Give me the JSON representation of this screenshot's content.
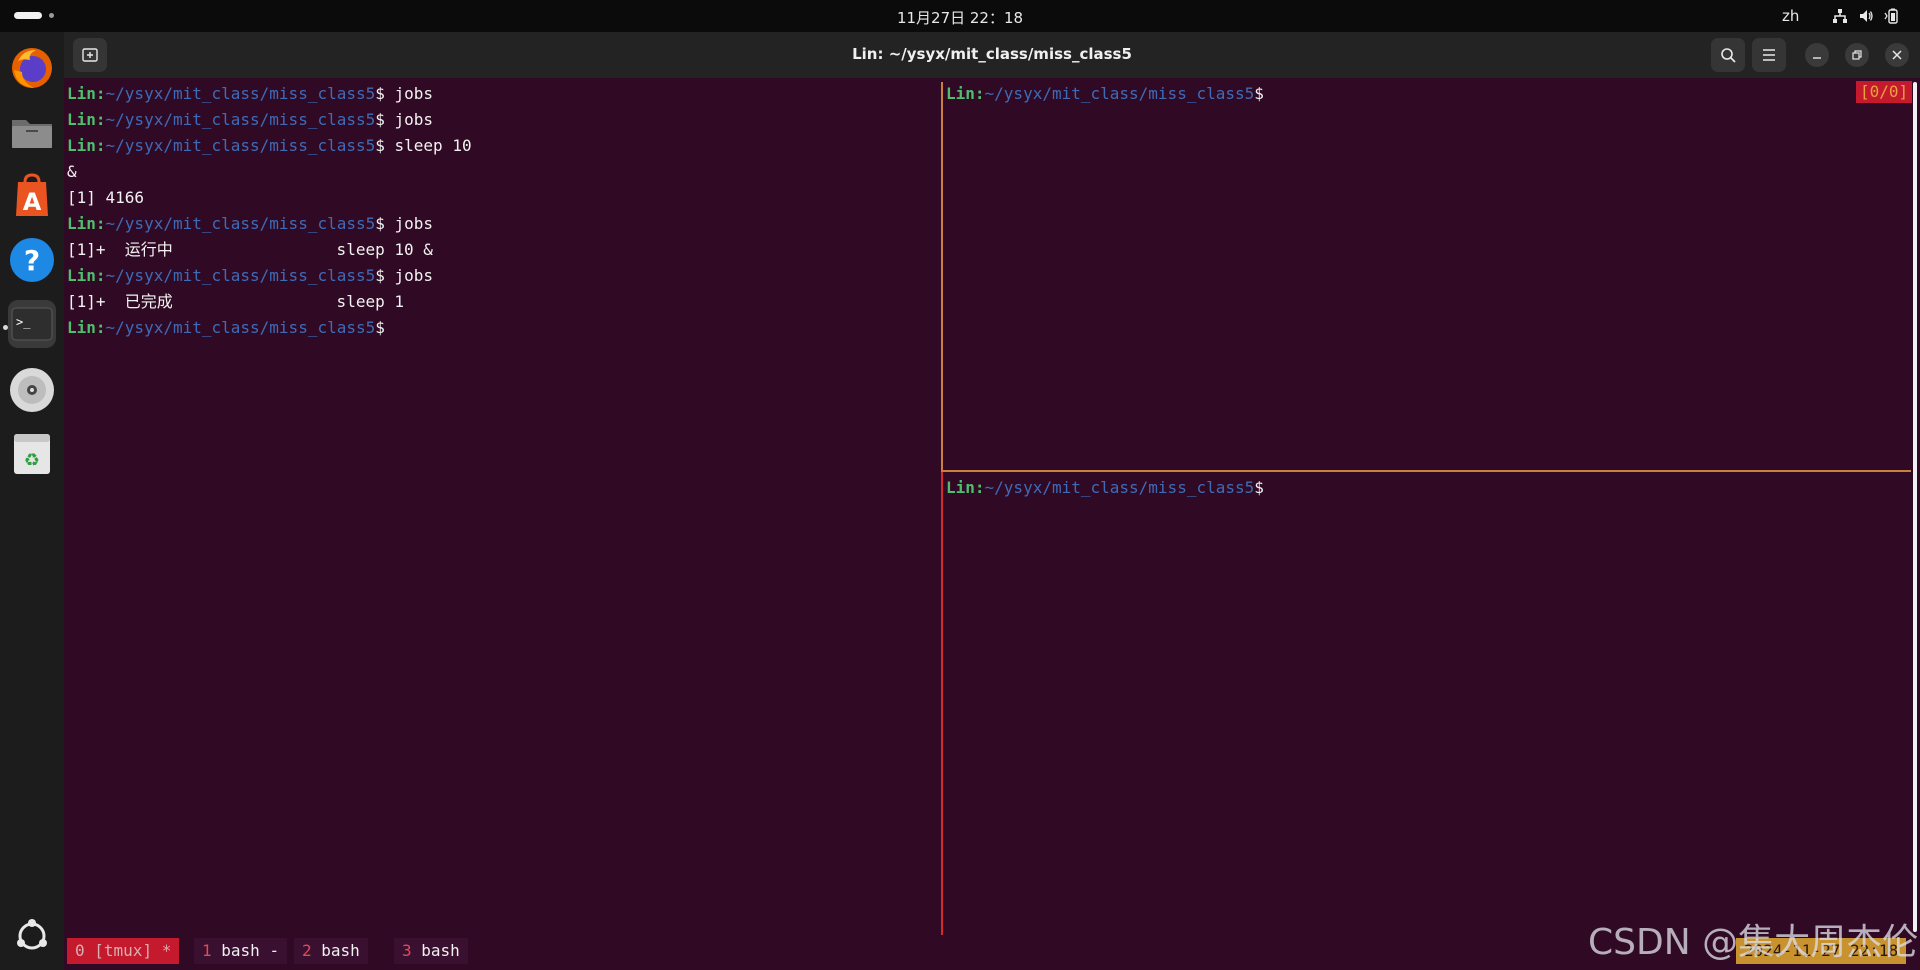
{
  "topbar": {
    "clock": "11月27日 22：18",
    "language": "zh"
  },
  "window": {
    "title": "Lin: ~/ysyx/mit_class/miss_class5"
  },
  "prompt": {
    "user": "Lin:",
    "path": "~/ysyx/mit_class/miss_class5",
    "symbol": "$"
  },
  "left_pane": {
    "lines": [
      {
        "user": "Lin:",
        "path": "~/ysyx/mit_class/miss_class5",
        "cmd": "$ jobs"
      },
      {
        "user": "Lin:",
        "path": "~/ysyx/mit_class/miss_class5",
        "cmd": "$ jobs"
      },
      {
        "user": "Lin:",
        "path": "~/ysyx/mit_class/miss_class5",
        "cmd": "$ sleep 10"
      },
      {
        "text": "&"
      },
      {
        "text": "[1] 4166"
      },
      {
        "user": "Lin:",
        "path": "~/ysyx/mit_class/miss_class5",
        "cmd": "$ jobs"
      },
      {
        "text": "[1]+  运行中                 sleep 10 &"
      },
      {
        "user": "Lin:",
        "path": "~/ysyx/mit_class/miss_class5",
        "cmd": "$ jobs"
      },
      {
        "text": "[1]+  已完成                 sleep 1"
      },
      {
        "user": "Lin:",
        "path": "~/ysyx/mit_class/miss_class5",
        "cmd": "$"
      }
    ]
  },
  "right_top_pane": {
    "prompt_cmd": "$",
    "position_indicator": "[0/0]"
  },
  "right_bottom_pane": {
    "prompt_cmd": "$"
  },
  "statusbar": {
    "windows": [
      {
        "index": "0",
        "label": " [tmux] *"
      },
      {
        "index": "1",
        "label": " bash -"
      },
      {
        "index": "2",
        "label": " bash"
      },
      {
        "index": "3",
        "label": " bash"
      }
    ],
    "clock": "2024-11-27 22:18"
  },
  "watermark": "CSDN @集大周杰伦",
  "colors": {
    "terminal_bg": "#300a24",
    "prompt_user": "#4fbf6f",
    "prompt_path": "#3e6bb8",
    "active_window": "#c5192d",
    "pane_border": "#c8803c"
  },
  "dock": {
    "items": [
      "firefox-icon",
      "files-icon",
      "app-center-icon",
      "help-icon",
      "terminal-icon",
      "disc-icon",
      "trash-icon",
      "show-apps-icon"
    ]
  }
}
